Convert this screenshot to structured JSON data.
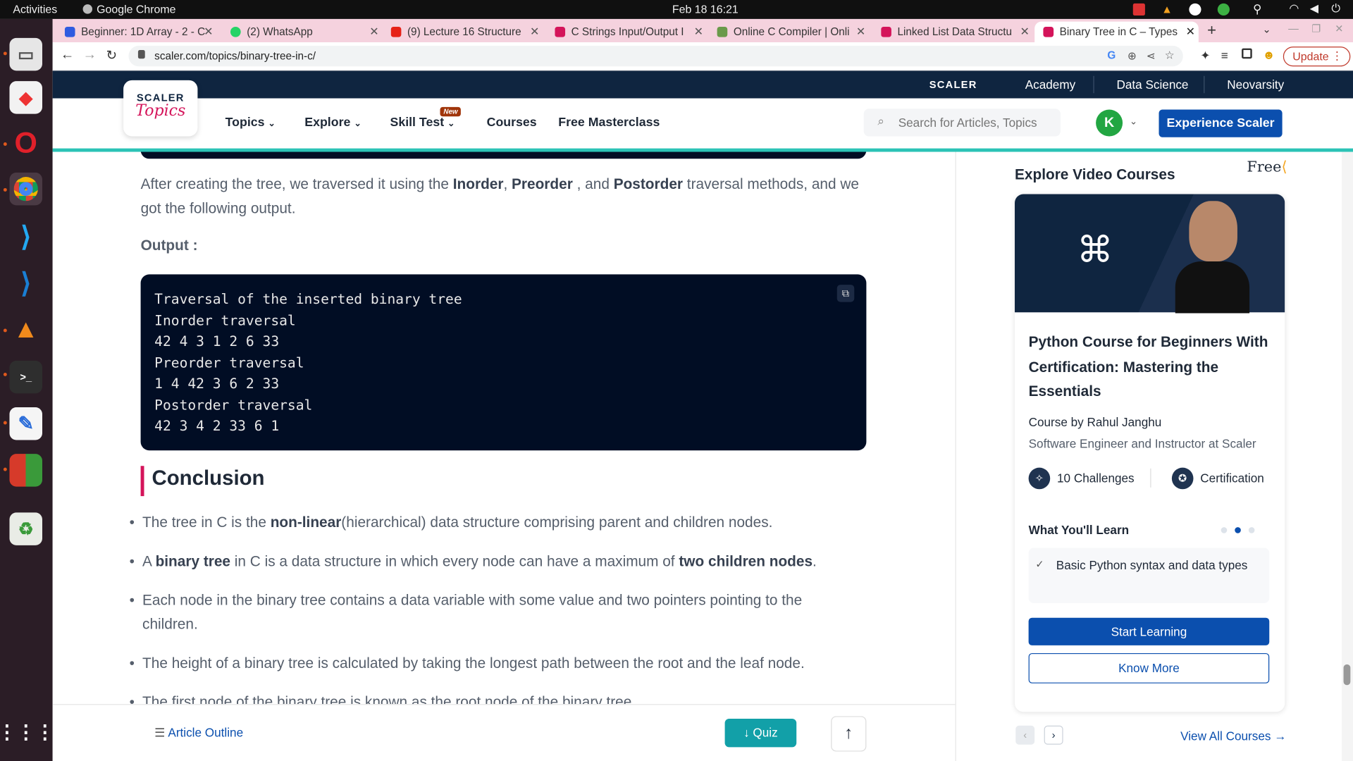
{
  "system": {
    "activities": "Activities",
    "app_name": "Google Chrome",
    "datetime": "Feb 18  16:21"
  },
  "tabs": [
    {
      "title": "Beginner: 1D Array - 2 - C",
      "color": "#2f5be0"
    },
    {
      "title": "(2) WhatsApp",
      "color": "#25d366"
    },
    {
      "title": "(9) Lecture 16 Structure",
      "color": "#e62117"
    },
    {
      "title": "C Strings Input/Output I",
      "color": "#d4145a"
    },
    {
      "title": "Online C Compiler | Onli",
      "color": "#6a9a4a"
    },
    {
      "title": "Linked List Data Structu",
      "color": "#d4145a"
    },
    {
      "title": "Binary Tree in C – Types",
      "color": "#d4145a",
      "active": true
    }
  ],
  "address": {
    "url": "scaler.com/topics/binary-tree-in-c/",
    "update_label": "Update"
  },
  "site": {
    "top_links": [
      "SCALER",
      "Academy",
      "Data Science",
      "Neovarsity"
    ],
    "logo_line1": "SCALER",
    "logo_line2": "Topics",
    "nav": {
      "topics": "Topics",
      "explore": "Explore",
      "skill_test": "Skill Test",
      "new_badge": "New",
      "courses": "Courses",
      "masterclass": "Free Masterclass"
    },
    "search_placeholder": "Search for Articles, Topics",
    "avatar_letter": "K",
    "cta": "Experience Scaler"
  },
  "article": {
    "intro_parts": [
      "After creating the tree, we traversed it using the ",
      "Inorder",
      ", ",
      "Preorder",
      " , and ",
      "Postorder",
      " traversal methods, and we got the following output."
    ],
    "output_label": "Output :",
    "code_lines": [
      "Traversal of the inserted binary tree",
      "Inorder traversal",
      "42 4 3 1 2 6 33",
      "Preorder traversal",
      "1 4 42 3 6 2 33",
      "Postorder traversal",
      "42 3 4 2 33 6 1"
    ],
    "conclusion_title": "Conclusion",
    "bullets": [
      {
        "a": "The tree in C is the ",
        "b": "non-linear",
        "c": "(hierarchical) data structure comprising parent and children nodes.",
        "d": "",
        "e": ""
      },
      {
        "a": "A ",
        "b": "binary tree",
        "c": " in C is a data structure in which every node can have a maximum of ",
        "d": "two children nodes",
        "e": "."
      },
      {
        "a": "Each node in the binary tree contains a data variable with some value and two pointers pointing to the children.",
        "b": "",
        "c": "",
        "d": "",
        "e": ""
      },
      {
        "a": "The height of a binary tree is calculated by taking the longest path between the root and the leaf node.",
        "b": "",
        "c": "",
        "d": "",
        "e": ""
      },
      {
        "a": "The first node of the binary tree is known as the root node of the binary tree.",
        "b": "",
        "c": "",
        "d": "",
        "e": ""
      }
    ]
  },
  "sidebar": {
    "heading": "Explore Video Courses",
    "free_badge": "Free",
    "course_title": "Python Course for Beginners With Certification: Mastering the Essentials",
    "author": "Course by Rahul Janghu",
    "author_role": "Software Engineer and Instructor at Scaler",
    "challenges": "10 Challenges",
    "certification": "Certification",
    "learn_heading": "What You'll Learn",
    "learn_item": "Basic Python syntax and data types",
    "start_button": "Start Learning",
    "know_more_button": "Know More",
    "view_all": "View All Courses"
  },
  "bottom": {
    "outline": "Article Outline",
    "quiz": "Quiz"
  }
}
